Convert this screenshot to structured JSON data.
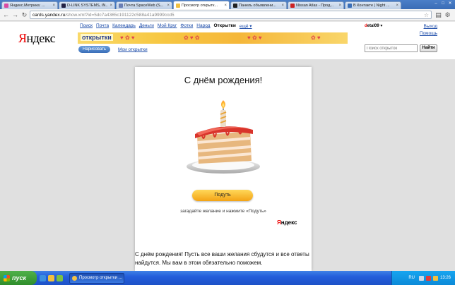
{
  "browser": {
    "tabs": [
      {
        "label": "Яндекс.Метрика: ...",
        "color": "#d94aa3"
      },
      {
        "label": "D-LINK SYSTEMS, IN...",
        "color": "#222244"
      },
      {
        "label": "Почта SpaceWeb (S...",
        "color": "#6a7fb5"
      },
      {
        "label": "Просмотр открытк...",
        "color": "#f0c040"
      },
      {
        "label": "Панель объявлени...",
        "color": "#222222"
      },
      {
        "label": "Nissan Atlas - Прод...",
        "color": "#cc2222"
      },
      {
        "label": "В Контакте | Night ...",
        "color": "#3b6fb8"
      }
    ],
    "url_domain": "cards.yandex.ru",
    "url_rest": "/show.xml?id=5dc7a4365c191122c588a41a9999ccd5"
  },
  "header": {
    "logo": "Яндекс",
    "nav": [
      "Поиск",
      "Почта",
      "Календарь",
      "Деньги",
      "Мой Круг",
      "Фотки",
      "Народ",
      "Открытки",
      "ещё ▾"
    ],
    "current_nav": "Открытки",
    "user": "detal09 ▾",
    "links": [
      "Выход",
      "Помощь"
    ],
    "banner_label": "открытки",
    "draw_button": "Нарисовать",
    "my_cards_link": "Мои открытки",
    "search_placeholder": "Поиск открыток",
    "search_button": "Найти"
  },
  "card": {
    "title": "С днём рождения!",
    "give_button": "Подуть",
    "wish_text": "загадайте желание и нажмите «Подуть»",
    "brand": "Яндекс",
    "message": "С днём рождения! Пусть все ваши желания сбудутся и все ответы найдутся. Мы вам в этом обязательно поможем."
  },
  "taskbar": {
    "start": "пуск",
    "task_label": "Просмотр открытки ...",
    "lang": "RU",
    "clock": "13:26"
  }
}
